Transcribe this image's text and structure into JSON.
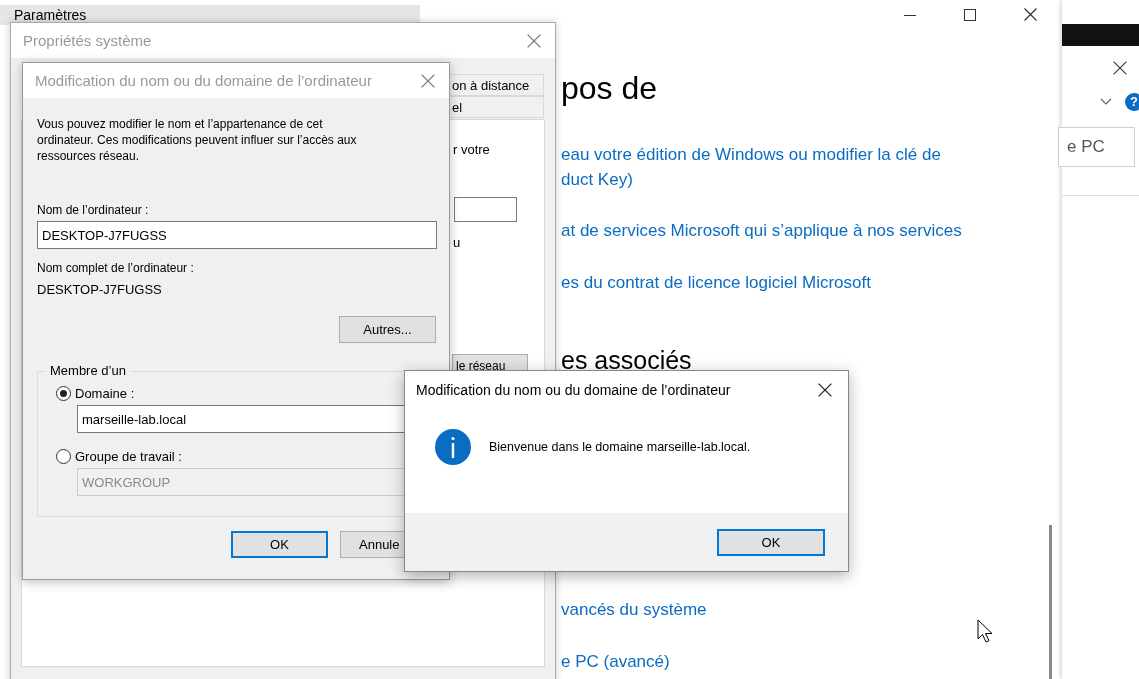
{
  "settings_window": {
    "title": "Paramètres",
    "items": [
      {
        "kind": "heading",
        "lines": [
          "pos de"
        ]
      },
      {
        "kind": "link",
        "lines": [
          "eau votre édition de Windows ou modifier la clé de",
          "duct Key)"
        ]
      },
      {
        "kind": "link",
        "lines": [
          "at de services Microsoft qui s’applique à nos services"
        ]
      },
      {
        "kind": "link",
        "lines": [
          "es du contrat de licence logiciel Microsoft"
        ]
      },
      {
        "kind": "subheading",
        "lines": [
          "es associés"
        ]
      },
      {
        "kind": "link",
        "lines": [
          "vancés du système"
        ]
      },
      {
        "kind": "link",
        "lines": [
          "e PC (avancé)"
        ]
      }
    ]
  },
  "side_window": {
    "help_glyph": "?",
    "search": {
      "placeholder": "e PC"
    }
  },
  "system_properties": {
    "title": "Propriétés système",
    "tabs": [
      {
        "label": "on à distance",
        "selected": false
      },
      {
        "label": "el",
        "selected": false
      }
    ],
    "panel": {
      "text_1": "r votre",
      "text_2": "u",
      "button": "le réseau"
    }
  },
  "name_dialog": {
    "title": "Modification du nom ou du domaine de l’ordinateur",
    "description": "Vous pouvez modifier le nom et l’appartenance de cet\nordinateur. Ces modifications peuvent influer sur l’accès aux\nressources réseau.",
    "name_label": "Nom de l’ordinateur :",
    "name_value": "DESKTOP-J7FUGSS",
    "full_name_label": "Nom complet de l’ordinateur :",
    "full_name": "DESKTOP-J7FUGSS",
    "more_button": "Autres...",
    "member_of": {
      "legend": "Membre d’un",
      "options": [
        {
          "label": "Domaine :",
          "selected": true,
          "value": "marseille-lab.local"
        },
        {
          "label": "Groupe de travail :",
          "selected": false,
          "value": "WORKGROUP"
        }
      ]
    },
    "buttons": [
      {
        "label": "OK",
        "default": true
      },
      {
        "label": "Annule",
        "default": false
      }
    ]
  },
  "message_box": {
    "title": "Modification du nom ou du domaine de l’ordinateur",
    "message": "Bienvenue dans le domaine marseille-lab.local.",
    "buttons": [
      {
        "label": "OK",
        "default": true
      }
    ]
  }
}
